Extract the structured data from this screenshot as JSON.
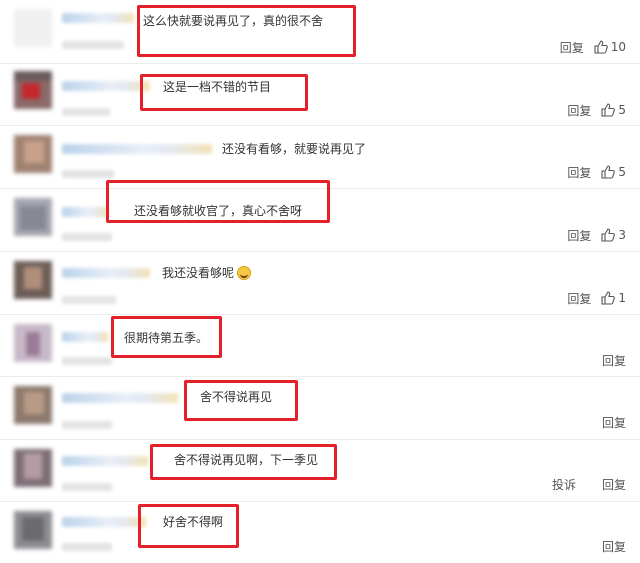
{
  "reply_label": "回复",
  "report_label": "投诉",
  "comments": [
    {
      "text": "这么快就要说再见了，真的很不舍",
      "likes": "10"
    },
    {
      "text": "这是一档不错的节目",
      "likes": "5"
    },
    {
      "text": "还没有看够，就要说再见了",
      "likes": "5"
    },
    {
      "text": "还没看够就收官了，真心不舍呀",
      "likes": "3"
    },
    {
      "text": "我还没看够呢",
      "likes": "1"
    },
    {
      "text": "很期待第五季。",
      "likes": ""
    },
    {
      "text": "舍不得说再见",
      "likes": ""
    },
    {
      "text": "舍不得说再见啊，下一季见",
      "likes": ""
    },
    {
      "text": "好舍不得啊",
      "likes": ""
    }
  ],
  "colors": {
    "highlight": "#e4202a",
    "name_blur": "#cfe0f1",
    "divider": "#ececec"
  },
  "icons": {
    "like": "thumbs-up-icon",
    "emoji": "laughing-emoji-icon"
  }
}
